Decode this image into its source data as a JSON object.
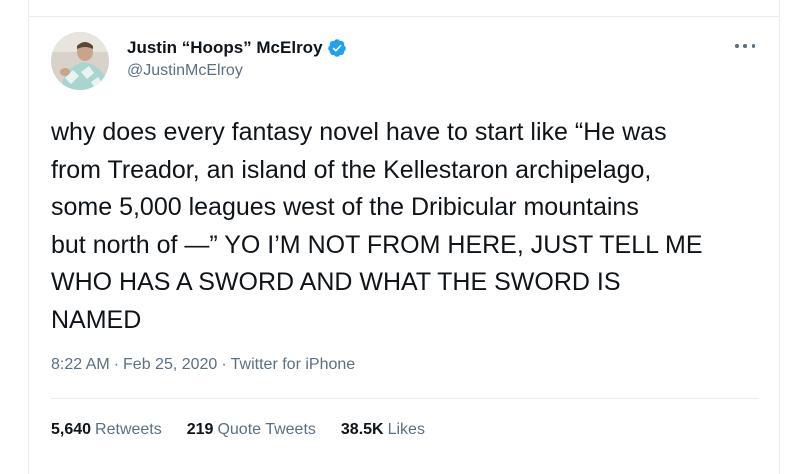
{
  "author": {
    "display_name": "Justin “Hoops” McElroy",
    "handle": "@JustinMcElroy",
    "verified": true,
    "avatar_icon": "profile-photo"
  },
  "tweet": {
    "text": "why does every fantasy novel have to start like “He was from Treador, an island of the Kellestaron archipelago, some 5,000 leagues west of the Dribicular mountains but north of —” YO I’M NOT FROM HERE, JUST TELL ME WHO HAS A SWORD AND WHAT THE SWORD IS NAMED",
    "lines": [
      "why does every fantasy novel have to start like “He was",
      "from Treador, an island of the Kellestaron archipelago,",
      "some 5,000 leagues west of the Dribicular mountains",
      "but north of —” YO I’M NOT FROM HERE, JUST TELL ME",
      "WHO HAS A SWORD AND WHAT THE SWORD IS",
      "NAMED"
    ],
    "time": "8:22 AM",
    "date": "Feb 25, 2020",
    "source": "Twitter for iPhone",
    "separator": "·"
  },
  "stats": {
    "retweets_count": "5,640",
    "retweets_label": "Retweets",
    "quotes_count": "219",
    "quotes_label": "Quote Tweets",
    "likes_count": "38.5K",
    "likes_label": "Likes"
  },
  "colors": {
    "text_primary": "#0f1419",
    "text_secondary": "#5b7083",
    "verified_blue": "#1da1f2",
    "border": "#e6ecf0"
  }
}
